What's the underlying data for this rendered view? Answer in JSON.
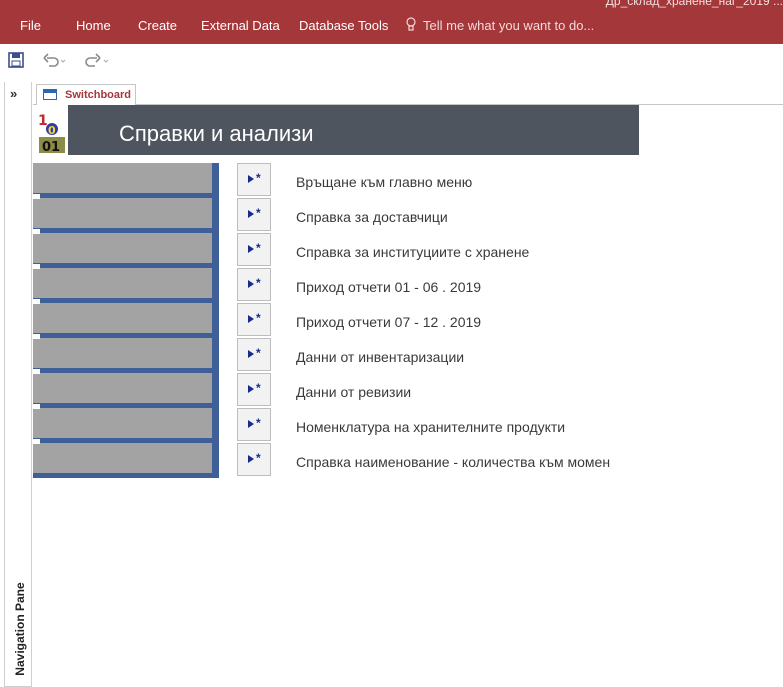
{
  "window": {
    "title_fragment": "Др_склад_хранене_наг_2019 ..."
  },
  "ribbon": {
    "tabs": [
      "File",
      "Home",
      "Create",
      "External Data",
      "Database Tools"
    ],
    "tell_me": "Tell me what you want to do..."
  },
  "nav_pane": {
    "label": "Navigation Pane",
    "toggle": "»"
  },
  "document_tab": {
    "label": "Switchboard"
  },
  "form": {
    "title": "Справки и анализи",
    "items": [
      "Връщане към главно меню",
      "Справка за доставчици",
      "Справка за институциите с хранене",
      "Приход отчети 01 - 06 . 2019",
      "Приход отчети 07 - 12 . 2019",
      "Данни от инвентаризации",
      "Данни от ревизии",
      "Номенклатура на хранителните продукти",
      "Справка наименование -  количества към момен"
    ]
  },
  "colors": {
    "ribbon": "#a4373a",
    "header": "#4f555e",
    "side_bar": "#3e5f97",
    "button_arrow": "#1a2a8a"
  }
}
